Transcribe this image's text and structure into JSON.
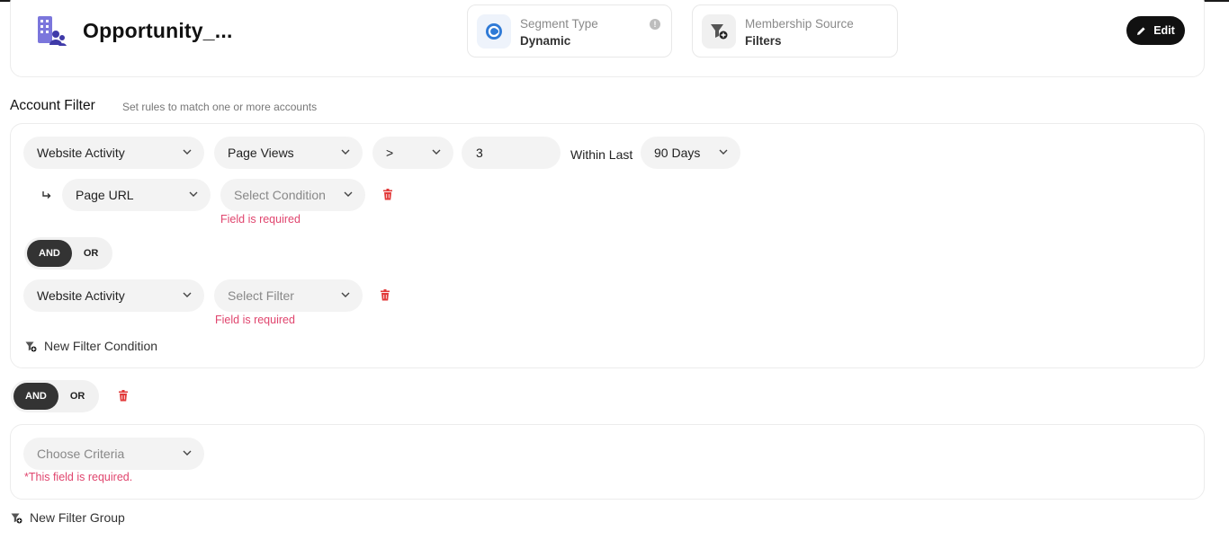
{
  "header": {
    "segment_name": "Opportunity_...",
    "segment_type": {
      "label": "Segment Type",
      "value": "Dynamic",
      "info_badge": "!"
    },
    "membership_source": {
      "label": "Membership Source",
      "value": "Filters"
    },
    "edit_label": "Edit"
  },
  "account_filter": {
    "title": "Account Filter",
    "subtitle": "Set rules to match one or more accounts",
    "rule1": {
      "category": "Website Activity",
      "metric": "Page Views",
      "operator": ">",
      "value": "3",
      "within_label": "Within Last",
      "period": "90 Days",
      "sub": {
        "field": "Page URL",
        "condition_placeholder": "Select Condition",
        "error": "Field is required"
      }
    },
    "join": {
      "and": "AND",
      "or": "OR",
      "active": "AND"
    },
    "rule2": {
      "category": "Website Activity",
      "filter_placeholder": "Select Filter",
      "error": "Field is required"
    },
    "new_condition_label": "New Filter Condition"
  },
  "group_join": {
    "and": "AND",
    "or": "OR",
    "active": "AND"
  },
  "criteria_group": {
    "placeholder": "Choose Criteria",
    "error": "*This field is required."
  },
  "new_group_label": "New Filter Group",
  "colors": {
    "accent": "#111111",
    "error": "#e0456e",
    "trash": "#e23a3a",
    "icon_purple": "#5b55c9"
  }
}
